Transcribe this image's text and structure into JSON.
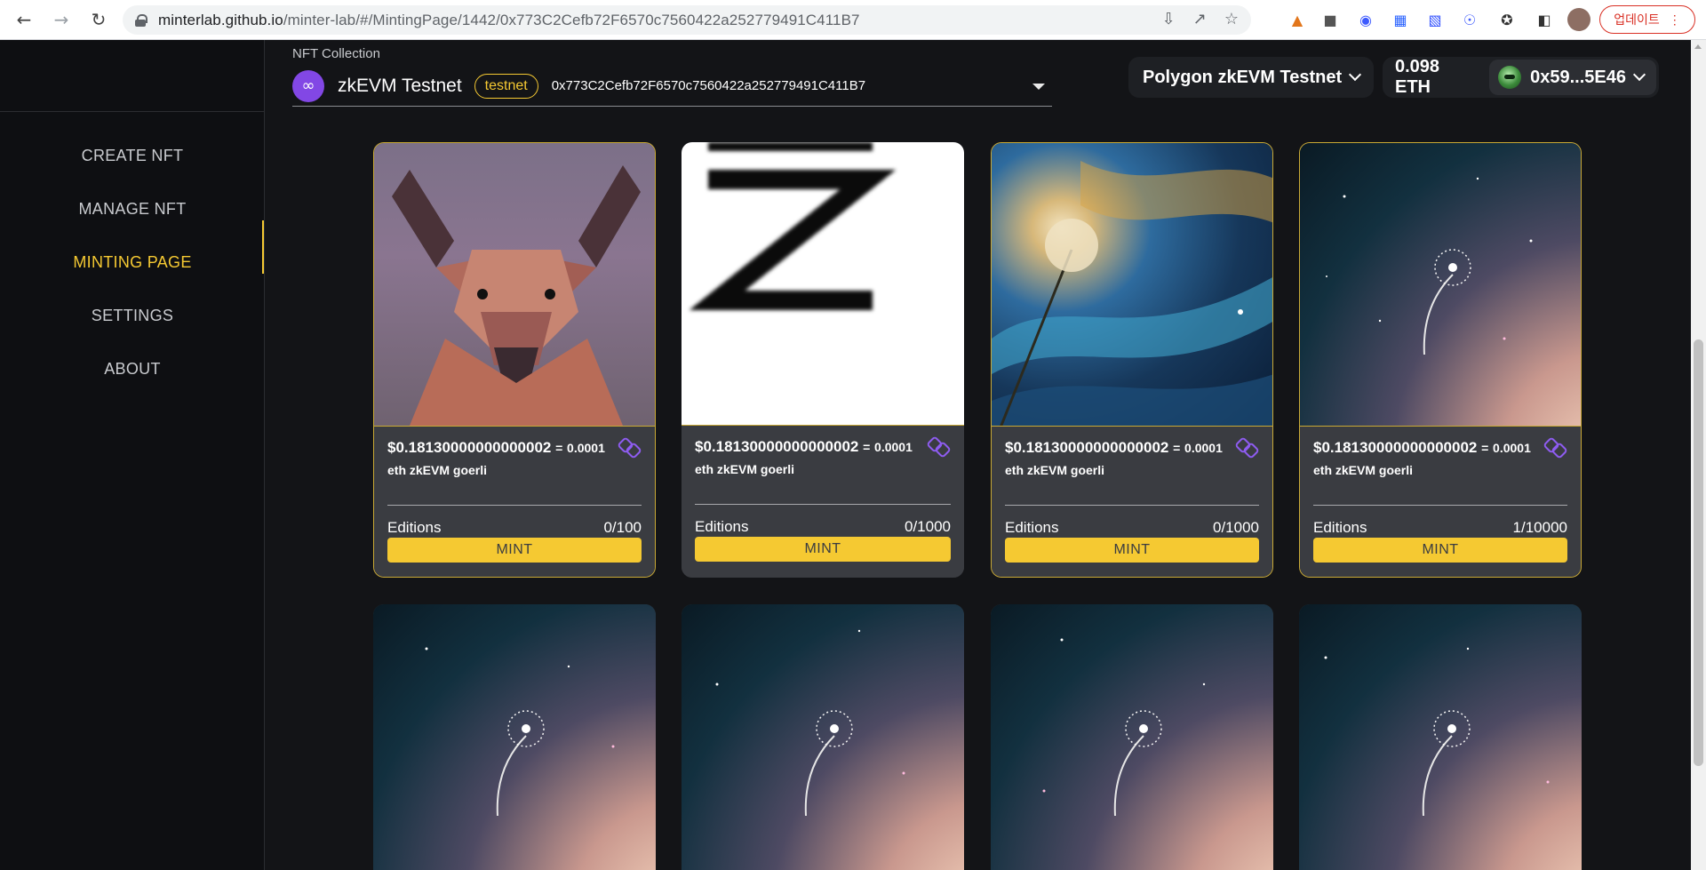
{
  "browser": {
    "url_host": "minterlab.github.io",
    "url_path": "/minter-lab/#/MintingPage/1442/0x773C2Cefb72F6570c7560422a252779491C411B7",
    "update_label": "업데이트"
  },
  "sidebar": {
    "items": [
      {
        "label": "CREATE NFT",
        "active": false
      },
      {
        "label": "MANAGE NFT",
        "active": false
      },
      {
        "label": "MINTING PAGE",
        "active": true
      },
      {
        "label": "SETTINGS",
        "active": false
      },
      {
        "label": "ABOUT",
        "active": false
      }
    ]
  },
  "header": {
    "collection_label": "NFT Collection",
    "collection_name": "zkEVM Testnet",
    "collection_badge": "testnet",
    "collection_address": "0x773C2Cefb72F6570c7560422a252779491C411B7",
    "network": "Polygon zkEVM Testnet",
    "balance": "0.098 ETH",
    "account": "0x59...5E46"
  },
  "cards": [
    {
      "price": "$0.18130000000000002",
      "eq": "=",
      "amount": "0.0001",
      "network_line": "eth zkEVM goerli",
      "editions_label": "Editions",
      "editions": "0/100",
      "mint_label": "MINT"
    },
    {
      "price": "$0.18130000000000002",
      "eq": "=",
      "amount": "0.0001",
      "network_line": "eth zkEVM goerli",
      "editions_label": "Editions",
      "editions": "0/1000",
      "mint_label": "MINT"
    },
    {
      "price": "$0.18130000000000002",
      "eq": "=",
      "amount": "0.0001",
      "network_line": "eth zkEVM goerli",
      "editions_label": "Editions",
      "editions": "0/1000",
      "mint_label": "MINT"
    },
    {
      "price": "$0.18130000000000002",
      "eq": "=",
      "amount": "0.0001",
      "network_line": "eth zkEVM goerli",
      "editions_label": "Editions",
      "editions": "1/10000",
      "mint_label": "MINT"
    }
  ],
  "colors": {
    "accent": "#f5c932",
    "polygon_purple": "#8247e5",
    "background": "#131417"
  }
}
